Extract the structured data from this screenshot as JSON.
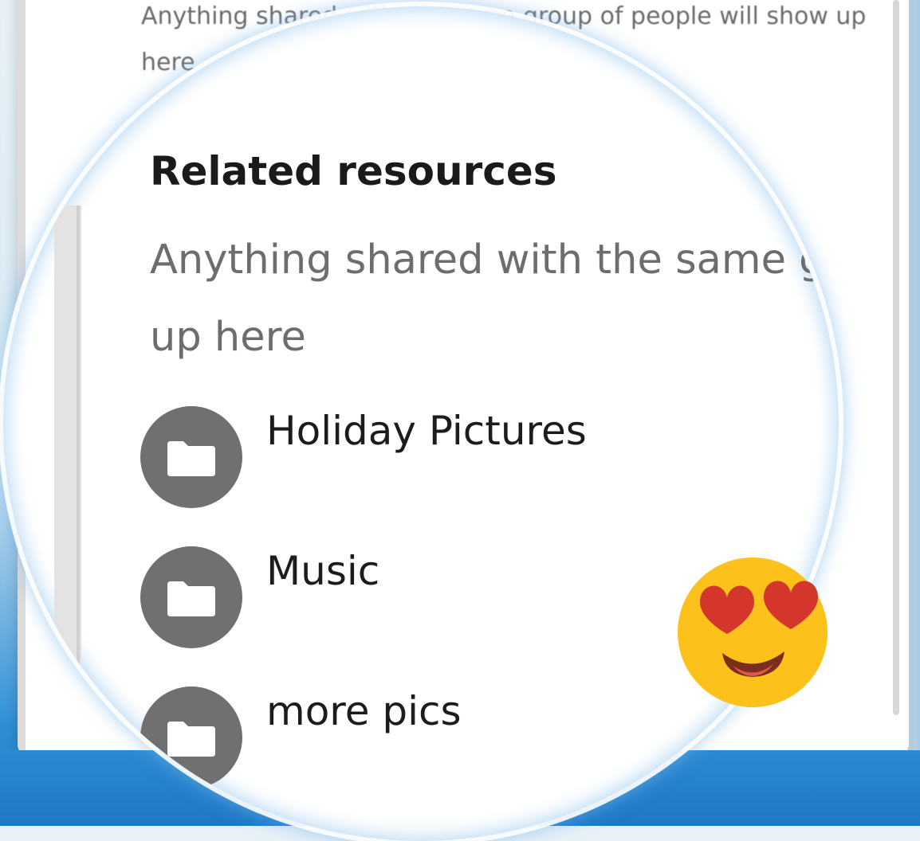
{
  "background_window": {
    "description": "Anything shared with the same group of people will show up here"
  },
  "magnified": {
    "section_title": "Related resources",
    "description_line1": "Anything shared with the same group of people will show",
    "description_line2": "up here",
    "resources": [
      {
        "label": "Holiday Pictures",
        "icon": "folder-icon"
      },
      {
        "label": "Music",
        "icon": "folder-icon"
      },
      {
        "label": "more pics",
        "icon": "folder-icon"
      }
    ]
  },
  "reaction": {
    "icon": "heart-eyes-emoji",
    "face_color": "#FCC21B",
    "heart_color": "#D4362C"
  },
  "colors": {
    "folder_circle": "#707070",
    "wallpaper": "#1E78C6"
  }
}
